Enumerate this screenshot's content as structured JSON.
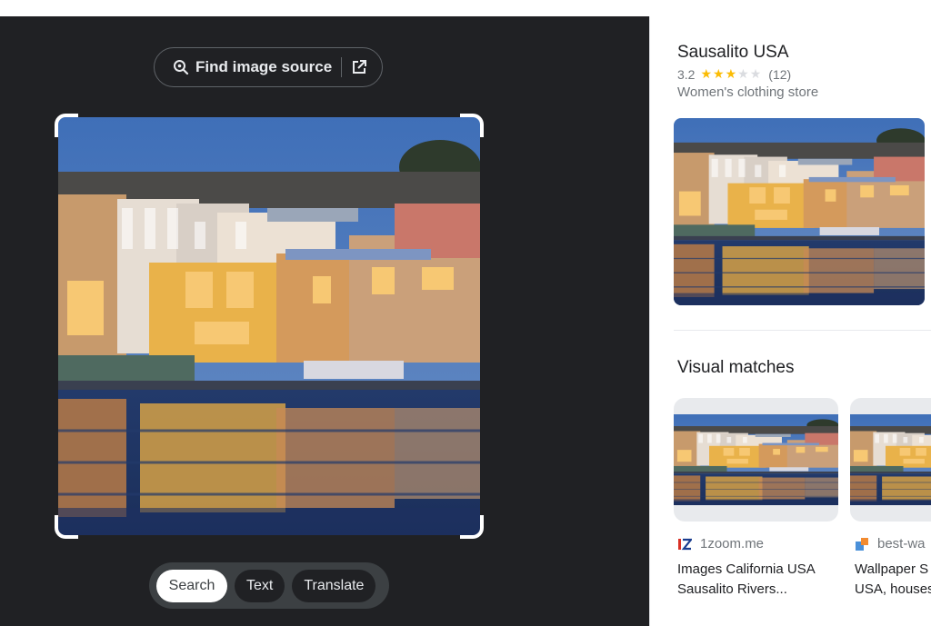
{
  "lens": {
    "find_source_label": "Find image source",
    "modes": [
      "Search",
      "Text",
      "Translate"
    ],
    "active_mode": "Search"
  },
  "result": {
    "title": "Sausalito USA",
    "rating": "3.2",
    "stars": 3,
    "max_stars": 5,
    "review_count": "(12)",
    "category": "Women's clothing store"
  },
  "visual_matches": {
    "heading": "Visual matches",
    "items": [
      {
        "source": "1zoom.me",
        "title_line1": "Images California USA",
        "title_line2": "Sausalito Rivers..."
      },
      {
        "source": "best-wa",
        "title_line1": "Wallpaper S",
        "title_line2": "USA, houses"
      }
    ]
  },
  "colors": {
    "panel_dark": "#202124",
    "star": "#fbbc04",
    "text_primary": "#202124",
    "text_secondary": "#70757a"
  },
  "icons": {
    "find_source": "lens-search-icon",
    "external_link": "open-external-icon",
    "favicon1": "1zoom-favicon",
    "favicon2": "best-wallpaper-favicon"
  }
}
